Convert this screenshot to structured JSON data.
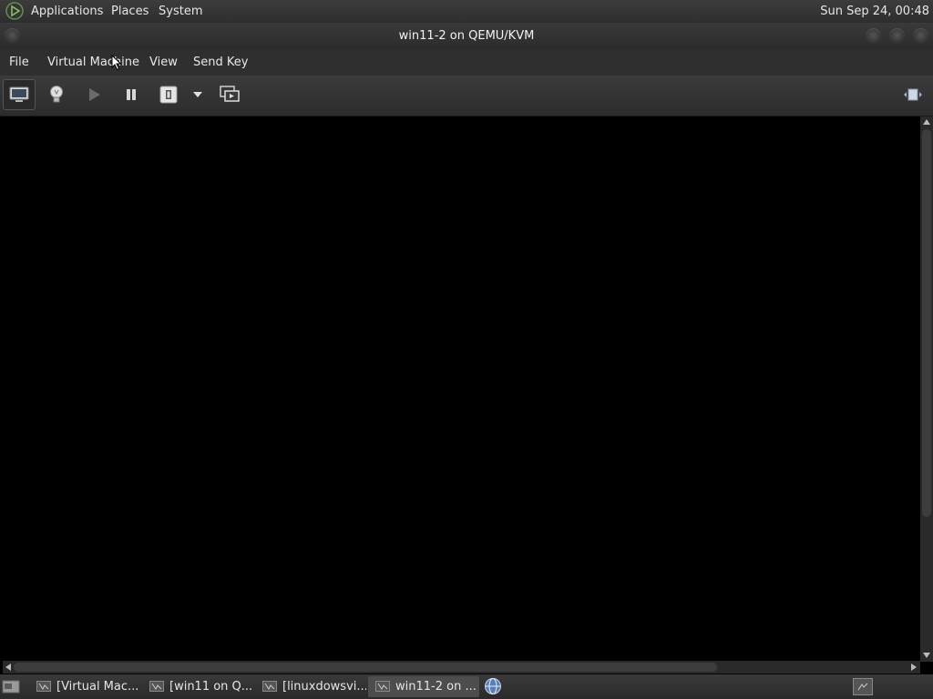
{
  "top_panel": {
    "menus": [
      "Applications",
      "Places",
      "System"
    ],
    "clock": "Sun Sep 24, 00:48"
  },
  "window": {
    "title": "win11-2 on QEMU/KVM"
  },
  "menubar": {
    "items": [
      "File",
      "Virtual Machine",
      "View",
      "Send Key"
    ]
  },
  "toolbar": {
    "buttons": [
      "console-icon",
      "lightbulb-icon",
      "play-icon",
      "pause-icon",
      "power-icon",
      "dropdown-arrow-icon",
      "snapshots-icon",
      "fullscreen-icon"
    ]
  },
  "taskbar": {
    "tasks": [
      "[Virtual Mac...",
      "[win11 on Q...",
      "[linuxdowsvi...",
      "win11-2 on ..."
    ],
    "active_task_index": 3
  },
  "colors": {
    "panel_bg": "#2f2f2f",
    "console_bg": "#000000",
    "text": "#e6e6e6"
  }
}
